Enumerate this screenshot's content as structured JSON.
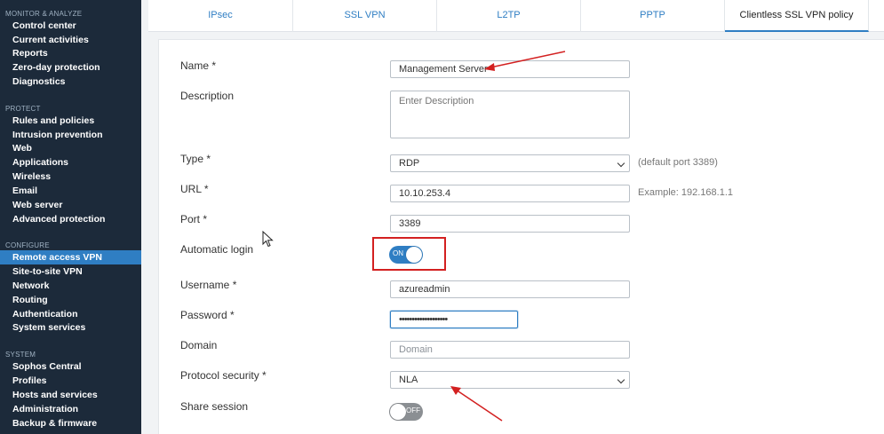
{
  "sidebar": {
    "sections": [
      {
        "title": "MONITOR & ANALYZE",
        "items": [
          "Control center",
          "Current activities",
          "Reports",
          "Zero-day protection",
          "Diagnostics"
        ]
      },
      {
        "title": "PROTECT",
        "items": [
          "Rules and policies",
          "Intrusion prevention",
          "Web",
          "Applications",
          "Wireless",
          "Email",
          "Web server",
          "Advanced protection"
        ]
      },
      {
        "title": "CONFIGURE",
        "items": [
          "Remote access VPN",
          "Site-to-site VPN",
          "Network",
          "Routing",
          "Authentication",
          "System services"
        ]
      },
      {
        "title": "SYSTEM",
        "items": [
          "Sophos Central",
          "Profiles",
          "Hosts and services",
          "Administration",
          "Backup & firmware"
        ]
      }
    ],
    "active_item": "Remote access VPN"
  },
  "tabs": [
    {
      "label": "IPsec",
      "active": false
    },
    {
      "label": "SSL VPN",
      "active": false
    },
    {
      "label": "L2TP",
      "active": false
    },
    {
      "label": "PPTP",
      "active": false
    },
    {
      "label": "Clientless SSL VPN policy",
      "active": true
    }
  ],
  "form": {
    "name_label": "Name *",
    "name_value": "Management Server",
    "description_label": "Description",
    "description_placeholder": "Enter Description",
    "type_label": "Type *",
    "type_value": "RDP",
    "type_hint": "(default port 3389)",
    "url_label": "URL *",
    "url_value": "10.10.253.4",
    "url_hint": "Example: 192.168.1.1",
    "port_label": "Port *",
    "port_value": "3389",
    "autologin_label": "Automatic login",
    "autologin_state": "ON",
    "username_label": "Username *",
    "username_value": "azureadmin",
    "password_label": "Password *",
    "password_value": "•••••••••••••••••••",
    "domain_label": "Domain",
    "domain_placeholder": "Domain",
    "protocol_label": "Protocol security *",
    "protocol_value": "NLA",
    "share_label": "Share session",
    "share_state": "OFF"
  },
  "colors": {
    "sidebar_bg": "#1c2a3a",
    "accent": "#2f7ec3",
    "annotation_red": "#d32020"
  }
}
